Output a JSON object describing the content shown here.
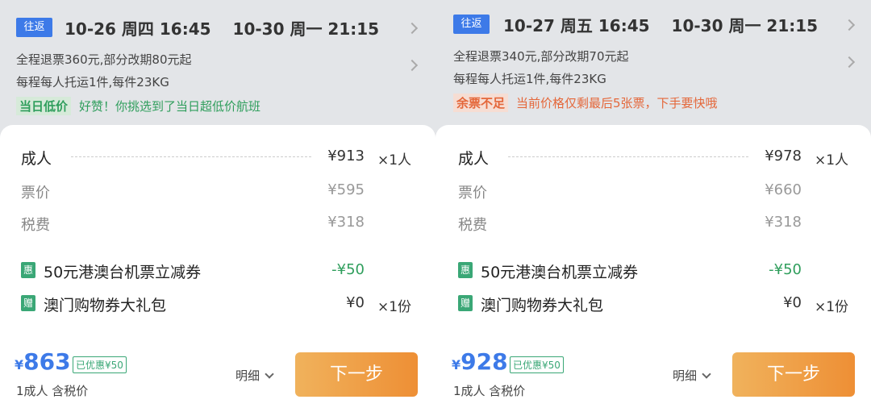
{
  "panels": [
    {
      "badge": "往返",
      "depart": "10-26 周四 16:45",
      "return": "10-30 周一 21:15",
      "refund": "全程退票360元,部分改期80元起",
      "baggage": "每程每人托运1件,每件23KG",
      "tag": "当日低价",
      "tag_text": "好赞！你挑选到了当日超低价航班",
      "adult_label": "成人",
      "adult_price": "¥913",
      "adult_qty": "×1人",
      "fare_label": "票价",
      "fare": "¥595",
      "tax_label": "税费",
      "tax": "¥318",
      "coupon_icon": "惠",
      "coupon_label": "50元港澳台机票立减券",
      "coupon_amount": "-¥50",
      "gift_icon": "赠",
      "gift_label": "澳门购物券大礼包",
      "gift_amount": "¥0",
      "gift_qty": "×1份",
      "currency": "¥",
      "total": "863",
      "discount_badge": "已优惠¥50",
      "total_sub": "1成人 含税价",
      "detail": "明细",
      "next": "下一步"
    },
    {
      "badge": "往返",
      "depart": "10-27 周五 16:45",
      "return": "10-30 周一 21:15",
      "refund": "全程退票340元,部分改期70元起",
      "baggage": "每程每人托运1件,每件23KG",
      "tag": "余票不足",
      "tag_text": "当前价格仅剩最后5张票，下手要快哦",
      "adult_label": "成人",
      "adult_price": "¥978",
      "adult_qty": "×1人",
      "fare_label": "票价",
      "fare": "¥660",
      "tax_label": "税费",
      "tax": "¥318",
      "coupon_icon": "惠",
      "coupon_label": "50元港澳台机票立减券",
      "coupon_amount": "-¥50",
      "gift_icon": "赠",
      "gift_label": "澳门购物券大礼包",
      "gift_amount": "¥0",
      "gift_qty": "×1份",
      "currency": "¥",
      "total": "928",
      "discount_badge": "已优惠¥50",
      "total_sub": "1成人 含税价",
      "detail": "明细",
      "next": "下一步"
    }
  ],
  "colors": {
    "accent": "#3d7ae8",
    "green": "#2f9e5c",
    "orange": "#e4673a",
    "button": "#ee8f35"
  }
}
